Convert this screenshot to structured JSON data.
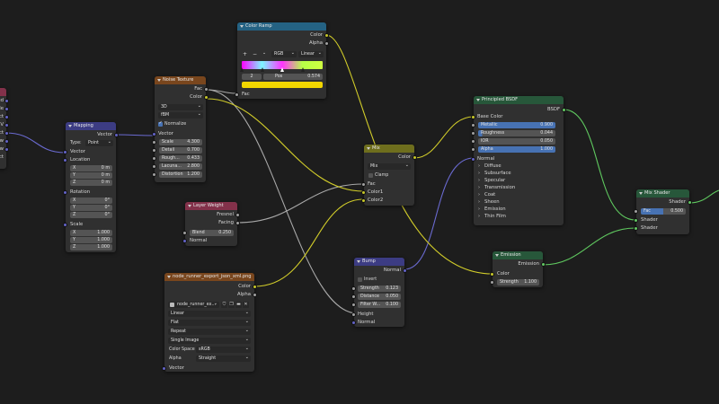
{
  "left_node": {
    "outputs": [
      "ed",
      "le",
      "ect",
      "UV",
      "ect",
      "ow",
      "ow",
      "ect"
    ]
  },
  "mapping": {
    "title": "Mapping",
    "vector_out": "Vector",
    "type_label": "Type:",
    "type_value": "Point",
    "vector_in": "Vector",
    "location_label": "Location",
    "location": [
      {
        "axis": "X",
        "value": "0 m"
      },
      {
        "axis": "Y",
        "value": "0 m"
      },
      {
        "axis": "Z",
        "value": "0 m"
      }
    ],
    "rotation_label": "Rotation",
    "rotation": [
      {
        "axis": "X",
        "value": "0°"
      },
      {
        "axis": "Y",
        "value": "0°"
      },
      {
        "axis": "Z",
        "value": "0°"
      }
    ],
    "scale_label": "Scale",
    "scale": [
      {
        "axis": "X",
        "value": "1.000"
      },
      {
        "axis": "Y",
        "value": "1.000"
      },
      {
        "axis": "Z",
        "value": "1.000"
      }
    ]
  },
  "noise": {
    "title": "Noise Texture",
    "fac_out": "Fac",
    "color_out": "Color",
    "dimensions": "3D",
    "type": "fBM",
    "normalize_label": "Normalize",
    "vector_in": "Vector",
    "fields": [
      {
        "label": "Scale",
        "value": "4.300"
      },
      {
        "label": "Detail",
        "value": "0.700"
      },
      {
        "label": "Rough...",
        "value": "0.433"
      },
      {
        "label": "Lacuna...",
        "value": "2.800"
      },
      {
        "label": "Distortion",
        "value": "1.200"
      }
    ]
  },
  "color_ramp": {
    "title": "Color Ramp",
    "color_out": "Color",
    "alpha_out": "Alpha",
    "plus": "+",
    "minus": "−",
    "more": "⌄",
    "color_mode": "RGB",
    "interpolation": "Linear",
    "index": "2",
    "pos_label": "Pos",
    "pos_value": "0.574",
    "selected_color": "#f2d600",
    "fac_in": "Fac",
    "ramp_stops": [
      {
        "pos": 0.0,
        "color": "#ff00ff"
      },
      {
        "pos": 0.25,
        "color": "#7df7ff"
      },
      {
        "pos": 0.5,
        "color": "#ff33ff"
      },
      {
        "pos": 0.75,
        "color": "#b7ff47"
      },
      {
        "pos": 1.0,
        "color": "#cfff40"
      }
    ]
  },
  "layer_weight": {
    "title": "Layer Weight",
    "fresnel_out": "Fresnel",
    "facing_out": "Facing",
    "blend_label": "Blend",
    "blend_value": "0.250",
    "normal_in": "Normal"
  },
  "image_texture": {
    "title": "node_runner_export_json_xml.png",
    "color_out": "Color",
    "alpha_out": "Alpha",
    "image_name": "node_runner_ex...",
    "interpolation": "Linear",
    "projection": "Flat",
    "extension": "Repeat",
    "source": "Single Image",
    "colorspace_label": "Color Space",
    "colorspace_value": "sRGB",
    "alpha_label": "Alpha",
    "alpha_value": "Straight",
    "vector_in": "Vector"
  },
  "mix": {
    "title": "Mix",
    "result_out": "Color",
    "blend_type": "Mix",
    "clamp_label": "Clamp",
    "fac_in": "Fac",
    "color1_in": "Color1",
    "color2_in": "Color2"
  },
  "bump": {
    "title": "Bump",
    "normal_out": "Normal",
    "invert_label": "Invert",
    "fields": [
      {
        "label": "Strength",
        "value": "0.123"
      },
      {
        "label": "Distance",
        "value": "0.050"
      },
      {
        "label": "Filter W...",
        "value": "0.100"
      }
    ],
    "height_in": "Height",
    "normal_in": "Normal"
  },
  "principled": {
    "title": "Principled BSDF",
    "bsdf_out": "BSDF",
    "base_color": "Base Color",
    "fields": [
      {
        "label": "Metallic",
        "value": "0.900"
      },
      {
        "label": "Roughness",
        "value": "0.044"
      },
      {
        "label": "IOR",
        "value": "0.050"
      },
      {
        "label": "Alpha",
        "value": "1.000"
      }
    ],
    "normal_in": "Normal",
    "panels": [
      "Diffuse",
      "Subsurface",
      "Specular",
      "Transmission",
      "Coat",
      "Sheen",
      "Emission",
      "Thin Film"
    ]
  },
  "emission": {
    "title": "Emission",
    "emission_out": "Emission",
    "color_in": "Color",
    "strength_label": "Strength",
    "strength_value": "1.100"
  },
  "mix_shader": {
    "title": "Mix Shader",
    "shader_out": "Shader",
    "fac_label": "Fac",
    "fac_value": "0.500",
    "shader1_in": "Shader",
    "shader2_in": "Shader"
  }
}
